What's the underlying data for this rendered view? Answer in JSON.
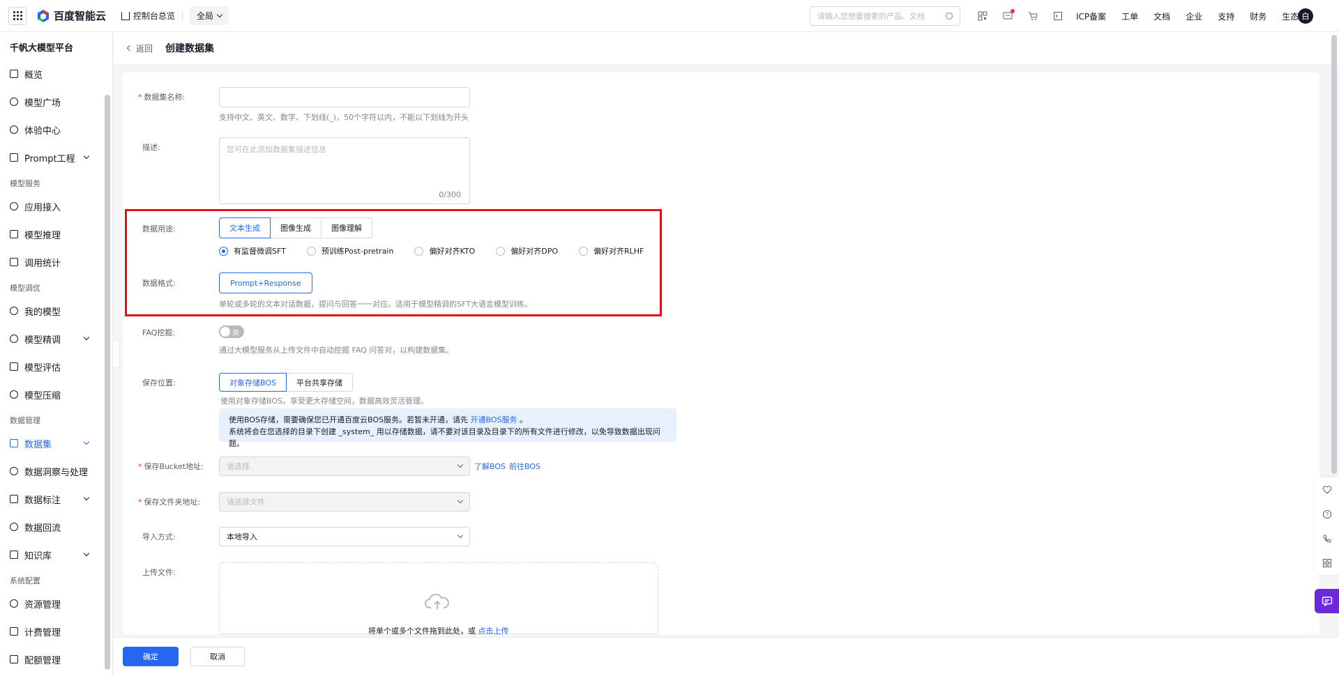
{
  "topnav": {
    "brand": "百度智能云",
    "console_home": "控制台总览",
    "region": "全局",
    "search_placeholder": "请输入您想要搜索的产品、文档",
    "links": [
      "ICP备案",
      "工单",
      "文档",
      "企业",
      "支持",
      "财务",
      "生态"
    ],
    "avatar_initial": "白",
    "icons": [
      "qrcode-icon",
      "message-icon",
      "cart-icon",
      "cloud-shell-icon"
    ]
  },
  "sidebar": {
    "title": "千帆大模型平台",
    "sections": [
      {
        "group": "",
        "items": [
          {
            "label": "概览",
            "icon": "grid-icon",
            "expandable": false,
            "active": false
          },
          {
            "label": "模型广场",
            "icon": "model-square-icon",
            "expandable": false,
            "active": false
          },
          {
            "label": "体验中心",
            "icon": "experience-icon",
            "expandable": false,
            "active": false
          },
          {
            "label": "Prompt工程",
            "icon": "prompt-icon",
            "expandable": true,
            "active": false
          }
        ]
      },
      {
        "group": "模型服务",
        "items": [
          {
            "label": "应用接入",
            "icon": "app-access-icon",
            "expandable": false,
            "active": false
          },
          {
            "label": "模型推理",
            "icon": "inference-icon",
            "expandable": false,
            "active": false
          },
          {
            "label": "调用统计",
            "icon": "stats-icon",
            "expandable": false,
            "active": false
          }
        ]
      },
      {
        "group": "模型调优",
        "items": [
          {
            "label": "我的模型",
            "icon": "my-model-icon",
            "expandable": false,
            "active": false
          },
          {
            "label": "模型精调",
            "icon": "fine-tune-icon",
            "expandable": true,
            "active": false
          },
          {
            "label": "模型评估",
            "icon": "evaluate-icon",
            "expandable": false,
            "active": false
          },
          {
            "label": "模型压缩",
            "icon": "compress-icon",
            "expandable": false,
            "active": false
          }
        ]
      },
      {
        "group": "数据管理",
        "items": [
          {
            "label": "数据集",
            "icon": "dataset-icon",
            "expandable": true,
            "active": true
          },
          {
            "label": "数据洞察与处理",
            "icon": "insight-icon",
            "expandable": false,
            "active": false
          },
          {
            "label": "数据标注",
            "icon": "annotation-icon",
            "expandable": true,
            "active": false
          },
          {
            "label": "数据回流",
            "icon": "backflow-icon",
            "expandable": false,
            "active": false
          },
          {
            "label": "知识库",
            "icon": "knowledge-icon",
            "expandable": true,
            "active": false
          }
        ]
      },
      {
        "group": "系统配置",
        "items": [
          {
            "label": "资源管理",
            "icon": "resource-icon",
            "expandable": false,
            "active": false
          },
          {
            "label": "计费管理",
            "icon": "billing-icon",
            "expandable": false,
            "active": false
          },
          {
            "label": "配额管理",
            "icon": "quota-icon",
            "expandable": false,
            "active": false
          }
        ]
      }
    ]
  },
  "header": {
    "back": "返回",
    "title": "创建数据集"
  },
  "form": {
    "name": {
      "label": "数据集名称:",
      "required": true,
      "value": "",
      "help": "支持中文、英文、数字、下划线(_)，50个字符以内，不能以下划线为开头"
    },
    "desc": {
      "label": "描述:",
      "placeholder": "您可在此添加数据集描述信息",
      "count": "0/300"
    },
    "usage": {
      "label": "数据用途:",
      "tabs": [
        {
          "label": "文本生成",
          "selected": true
        },
        {
          "label": "图像生成",
          "selected": false
        },
        {
          "label": "图像理解",
          "selected": false
        }
      ],
      "radios": [
        {
          "label": "有监督微调SFT",
          "checked": true
        },
        {
          "label": "预训练Post-pretrain",
          "checked": false
        },
        {
          "label": "偏好对齐KTO",
          "checked": false
        },
        {
          "label": "偏好对齐DPO",
          "checked": false
        },
        {
          "label": "偏好对齐RLHF",
          "checked": false
        }
      ]
    },
    "format": {
      "label": "数据格式:",
      "chip": "Prompt+Response",
      "help": "单轮或多轮的文本对话数据，提问与回答一一对应。适用于模型精调的SFT大语言模型训练。"
    },
    "faq": {
      "label": "FAQ挖掘:",
      "toggle_text": "关",
      "toggle_on": false,
      "help": "通过大模型服务从上传文件中自动挖掘 FAQ 问答对，以构建数据集。"
    },
    "storage": {
      "label": "保存位置:",
      "tabs": [
        {
          "label": "对象存储BOS",
          "selected": true
        },
        {
          "label": "平台共享存储",
          "selected": false
        }
      ],
      "help": "使用对象存储BOS，享受更大存储空间，数据高效灵活管理。",
      "notice_line1_a": "使用BOS存储，需要确保您已开通百度云BOS服务。若暂未开通，请先",
      "notice_line1_link": "开通BOS服务",
      "notice_line1_b": "。",
      "notice_line2": "系统将会在您选择的目录下创建 _system_ 用以存储数据，请不要对该目录及目录下的所有文件进行修改，以免导致数据出现问题。"
    },
    "bucket": {
      "label": "保存Bucket地址:",
      "required": true,
      "placeholder": "请选择",
      "link1": "了解BOS",
      "link2": "前往BOS"
    },
    "folder": {
      "label": "保存文件夹地址:",
      "required": true,
      "placeholder": "请选择文件"
    },
    "import": {
      "label": "导入方式:",
      "value": "本地导入"
    },
    "upload": {
      "label": "上传文件:",
      "text": "将单个或多个文件拖到此处，或",
      "link": "点击上传"
    }
  },
  "footer": {
    "confirm": "确定",
    "cancel": "取消"
  },
  "colors": {
    "primary": "#2468f2",
    "highlight": "#e0101d",
    "notice_bg": "#e6f0ff",
    "float_chat": "#6d28d9"
  },
  "float_tools": [
    "heart-icon",
    "help-icon",
    "phone-icon",
    "apps-icon"
  ],
  "float_chat_icon": "chat-icon"
}
